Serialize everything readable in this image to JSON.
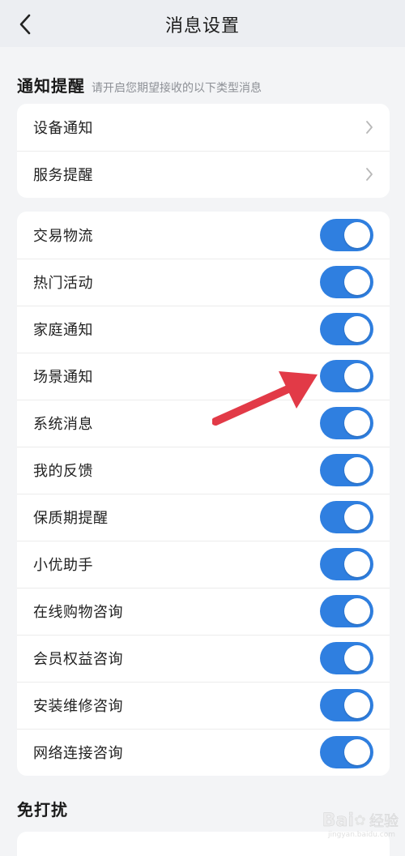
{
  "header": {
    "title": "消息设置",
    "back_icon": "chevron-left-icon"
  },
  "notifications": {
    "title": "通知提醒",
    "subtitle": "请开启您期望接收的以下类型消息",
    "nav_items": [
      {
        "label": "设备通知"
      },
      {
        "label": "服务提醒"
      }
    ],
    "toggle_items": [
      {
        "label": "交易物流",
        "on": true
      },
      {
        "label": "热门活动",
        "on": true
      },
      {
        "label": "家庭通知",
        "on": true
      },
      {
        "label": "场景通知",
        "on": true
      },
      {
        "label": "系统消息",
        "on": true
      },
      {
        "label": "我的反馈",
        "on": true
      },
      {
        "label": "保质期提醒",
        "on": true
      },
      {
        "label": "小优助手",
        "on": true
      },
      {
        "label": "在线购物咨询",
        "on": true
      },
      {
        "label": "会员权益咨询",
        "on": true
      },
      {
        "label": "安装维修咨询",
        "on": true
      },
      {
        "label": "网络连接咨询",
        "on": true
      }
    ]
  },
  "dnd": {
    "title": "免打扰"
  },
  "watermark": {
    "logo": "Bai",
    "text": "经验",
    "sub": "jingyan.baidu.com"
  },
  "colors": {
    "toggle_on": "#2f7fe0",
    "annotation_arrow": "#e23a47",
    "page_bg": "#f3f4f6"
  }
}
